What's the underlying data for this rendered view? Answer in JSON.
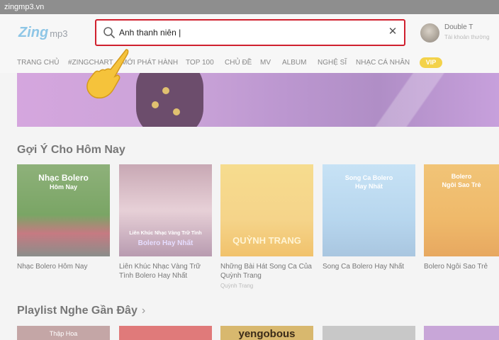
{
  "window": {
    "title": "zingmp3.vn"
  },
  "logo": {
    "brand": "Zing",
    "suffix": "mp3"
  },
  "search": {
    "value": "Anh thanh niên |"
  },
  "user": {
    "name": "Double T",
    "subtitle": "Tài khoản thường"
  },
  "nav": {
    "items": [
      {
        "label": "TRANG CHỦ"
      },
      {
        "label": "#ZINGCHART"
      },
      {
        "label": "MỚI PHÁT HÀNH"
      },
      {
        "label": "TOP 100"
      },
      {
        "label": "CHỦ ĐỀ"
      },
      {
        "label": "MV"
      },
      {
        "label": "ALBUM"
      },
      {
        "label": "NGHỆ SĨ"
      },
      {
        "label": "NHẠC CÁ NHÂN"
      }
    ],
    "vip": "VIP"
  },
  "suggest": {
    "title": "Gợi Ý Cho Hôm Nay",
    "cards": [
      {
        "title": "Nhạc Bolero Hôm Nay",
        "sub": "",
        "thumb_line1": "Nhạc Bolero",
        "thumb_line2": "Hôm Nay",
        "color": "#7aa565"
      },
      {
        "title": "Liên Khúc Nhạc Vàng Trữ Tình Bolero Hay Nhất",
        "sub": "",
        "thumb_line1": "Liên Khúc Nhạc Vàng Trữ Tình",
        "thumb_line2": "Bolero Hay Nhất",
        "color": "#d8b8c2"
      },
      {
        "title": "Những Bài Hát Song Ca Của Quỳnh Trang",
        "sub": "Quỳnh Trang",
        "thumb_line1": "QUỲNH TRANG",
        "thumb_line2": "",
        "color": "#f6dc8e"
      },
      {
        "title": "Song Ca Bolero Hay Nhất",
        "sub": "",
        "thumb_line1": "Song Ca Bolero",
        "thumb_line2": "Hay Nhất",
        "color": "#b7d6ee"
      },
      {
        "title": "Bolero Ngôi Sao Trẻ",
        "sub": "",
        "thumb_line1": "Bolero",
        "thumb_line2": "Ngôi Sao Trẻ",
        "color": "#efb96a"
      }
    ]
  },
  "recent": {
    "title": "Playlist Nghe Gần Đây",
    "chevron_icon": "chevron-right-icon",
    "cards": [
      {
        "label": "Thập Hoa",
        "color": "#c4a6a6"
      },
      {
        "label": "",
        "color": "#e07a7a"
      },
      {
        "label": "yengobous",
        "color": "#d8b86e"
      },
      {
        "label": "",
        "color": "#c8c8c8"
      },
      {
        "label": "",
        "color": "#c8a6d8"
      }
    ]
  },
  "colors": {
    "accent": "#d0202e",
    "vip": "#f3d24a"
  }
}
